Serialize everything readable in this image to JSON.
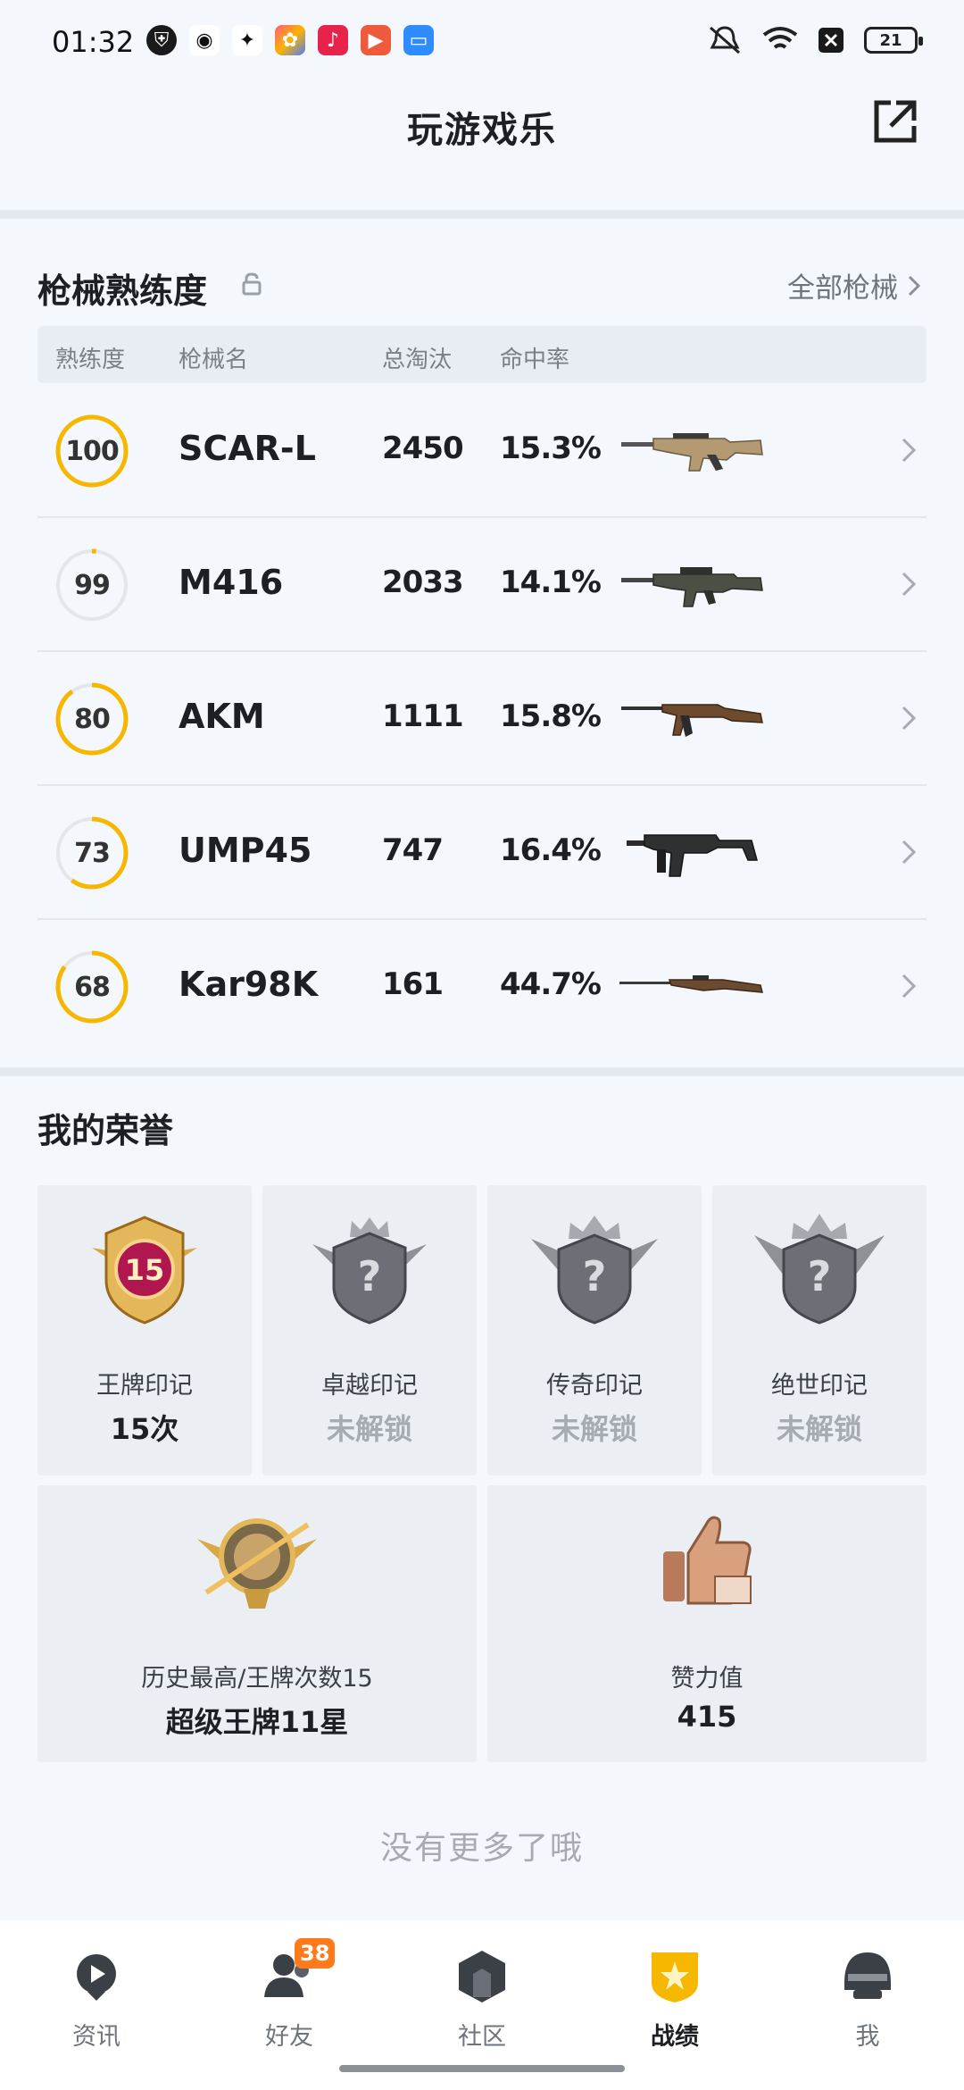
{
  "status_bar": {
    "time": "01:32",
    "battery": "21"
  },
  "header": {
    "title": "玩游戏乐"
  },
  "weapons": {
    "title": "枪械熟练度",
    "all_link": "全部枪械",
    "columns": {
      "proficiency": "熟练度",
      "name": "枪械名",
      "kills": "总淘汰",
      "hit_rate": "命中率"
    },
    "rows": [
      {
        "proficiency": "100",
        "progress": 1.0,
        "name": "SCAR-L",
        "kills": "2450",
        "hit_rate": "15.3%"
      },
      {
        "proficiency": "99",
        "progress": 0.02,
        "name": "M416",
        "kills": "2033",
        "hit_rate": "14.1%"
      },
      {
        "proficiency": "80",
        "progress": 0.9,
        "name": "AKM",
        "kills": "1111",
        "hit_rate": "15.8%"
      },
      {
        "proficiency": "73",
        "progress": 0.6,
        "name": "UMP45",
        "kills": "747",
        "hit_rate": "16.4%"
      },
      {
        "proficiency": "68",
        "progress": 0.85,
        "name": "Kar98K",
        "kills": "161",
        "hit_rate": "44.7%"
      }
    ]
  },
  "honors": {
    "title": "我的荣誉",
    "badges": [
      {
        "title": "王牌印记",
        "value": "15次",
        "number": "15"
      },
      {
        "title": "卓越印记",
        "value": "未解锁"
      },
      {
        "title": "传奇印记",
        "value": "未解锁"
      },
      {
        "title": "绝世印记",
        "value": "未解锁"
      }
    ],
    "highest": {
      "title": "历史最高/王牌次数15",
      "value": "超级王牌11星"
    },
    "likes": {
      "title": "赞力值",
      "value": "415"
    }
  },
  "no_more": "没有更多了哦",
  "nav": {
    "items": [
      {
        "label": "资讯"
      },
      {
        "label": "好友",
        "badge": "38"
      },
      {
        "label": "社区"
      },
      {
        "label": "战绩"
      },
      {
        "label": "我"
      }
    ]
  },
  "colors": {
    "accent": "#f5b700",
    "background": "#f4f7fb",
    "badge": "#ff7a1a"
  }
}
